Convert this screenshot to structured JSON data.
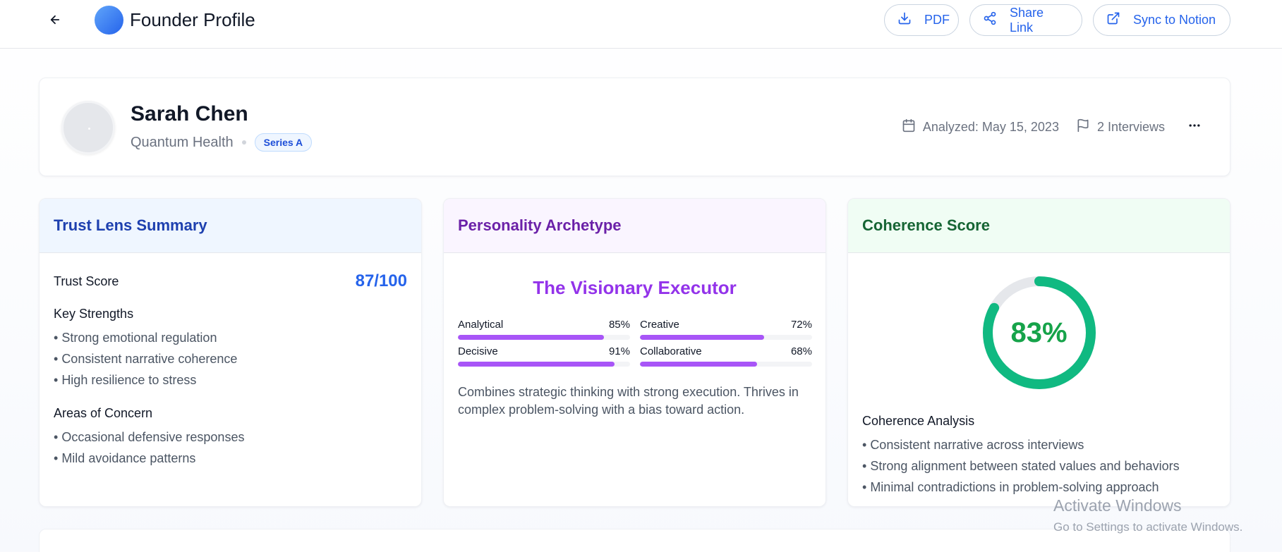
{
  "header": {
    "title": "Founder Profile",
    "buttons": {
      "pdf": "PDF",
      "share": "Share Link",
      "sync": "Sync to Notion"
    }
  },
  "profile": {
    "name": "Sarah Chen",
    "company": "Quantum Health",
    "stage": "Series A",
    "analyzed": "Analyzed: May 15, 2023",
    "interviews": "2 Interviews"
  },
  "trust_lens": {
    "title": "Trust Lens Summary",
    "score_label": "Trust Score",
    "score_value": "87/100",
    "strengths_heading": "Key Strengths",
    "strengths": [
      "Strong emotional regulation",
      "Consistent narrative coherence",
      "High resilience to stress"
    ],
    "concerns_heading": "Areas of Concern",
    "concerns": [
      "Occasional defensive responses",
      "Mild avoidance patterns"
    ]
  },
  "personality": {
    "title": "Personality Archetype",
    "archetype": "The Visionary Executor",
    "traits": [
      {
        "label": "Analytical",
        "value_text": "85%",
        "value": 85
      },
      {
        "label": "Creative",
        "value_text": "72%",
        "value": 72
      },
      {
        "label": "Decisive",
        "value_text": "91%",
        "value": 91
      },
      {
        "label": "Collaborative",
        "value_text": "68%",
        "value": 68
      }
    ],
    "description": "Combines strategic thinking with strong execution. Thrives in complex problem-solving with a bias toward action."
  },
  "coherence": {
    "title": "Coherence Score",
    "score_text": "83%",
    "score": 83,
    "analysis_heading": "Coherence Analysis",
    "analysis": [
      "Consistent narrative across interviews",
      "Strong alignment between stated values and behaviors",
      "Minimal contradictions in problem-solving approach"
    ]
  },
  "watermark": {
    "title": "Activate Windows",
    "subtitle": "Go to Settings to activate Windows."
  },
  "colors": {
    "accent_blue": "#2563eb",
    "accent_purple": "#a855f7",
    "accent_green": "#10b981",
    "score_green": "#16a34a"
  },
  "icons": {
    "back": "arrow-left-icon",
    "pdf": "download-icon",
    "share": "share-icon",
    "sync": "external-link-icon",
    "analyzed": "calendar-icon",
    "interviews": "flag-icon",
    "more": "more-horizontal-icon"
  }
}
